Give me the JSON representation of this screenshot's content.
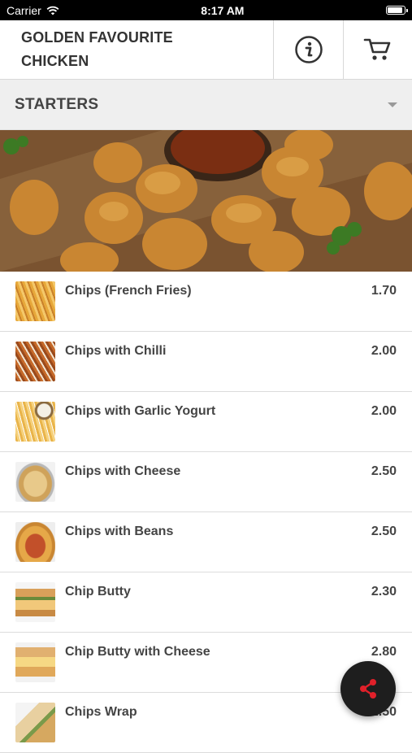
{
  "status_bar": {
    "carrier": "Carrier",
    "time": "8:17 AM"
  },
  "header": {
    "title_line1": "GOLDEN FAVOURITE",
    "title_line2": "CHICKEN",
    "info_icon": "info-icon",
    "cart_icon": "cart-icon"
  },
  "category": {
    "label": "STARTERS",
    "dropdown_icon": "chevron-down-icon"
  },
  "banner": {
    "icon": "fried-chicken-photo"
  },
  "items": [
    {
      "name": "Chips (French Fries)",
      "price": "1.70"
    },
    {
      "name": "Chips with Chilli",
      "price": "2.00"
    },
    {
      "name": "Chips with Garlic Yogurt",
      "price": "2.00"
    },
    {
      "name": "Chips with Cheese",
      "price": "2.50"
    },
    {
      "name": "Chips with Beans",
      "price": "2.50"
    },
    {
      "name": "Chip Butty",
      "price": "2.30"
    },
    {
      "name": "Chip Butty with Cheese",
      "price": "2.80"
    },
    {
      "name": "Chips Wrap",
      "price": "2.50"
    }
  ],
  "fab": {
    "icon": "share-icon",
    "color": "#e0202a"
  },
  "colors": {
    "status_bg": "#000000",
    "category_bg": "#efefef",
    "text": "#444444",
    "fab_bg": "#1e1e1e"
  }
}
